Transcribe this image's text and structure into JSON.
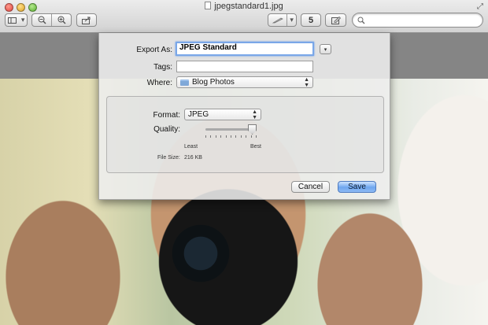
{
  "window": {
    "title": "jpegstandard1.jpg",
    "traffic_lights": [
      "close",
      "minimize",
      "zoom"
    ]
  },
  "toolbar": {
    "view_button_icons": [
      "sidebar-view-icon",
      "chevron-down-icon"
    ],
    "zoom_icons": [
      "zoom-out-icon",
      "zoom-in-icon"
    ],
    "share_icon": "share-icon",
    "markup_icons": [
      "pen-icon",
      "chevron-down-icon"
    ],
    "rotate_label": "5",
    "edit_icon": "edit-icon",
    "search_placeholder": ""
  },
  "export_sheet": {
    "export_as_label": "Export As:",
    "export_as_value": "JPEG Standard",
    "tags_label": "Tags:",
    "tags_value": "",
    "where_label": "Where:",
    "where_value": "Blog Photos",
    "format_label": "Format:",
    "format_value": "JPEG",
    "quality_label": "Quality:",
    "quality_level": 1.0,
    "quality_min_label": "Least",
    "quality_max_label": "Best",
    "file_size_label": "File Size:",
    "file_size_value": "216 KB",
    "cancel_label": "Cancel",
    "save_label": "Save"
  },
  "colors": {
    "accent_blue": "#6ea6ef",
    "focus_ring": "#7aa7e8"
  }
}
